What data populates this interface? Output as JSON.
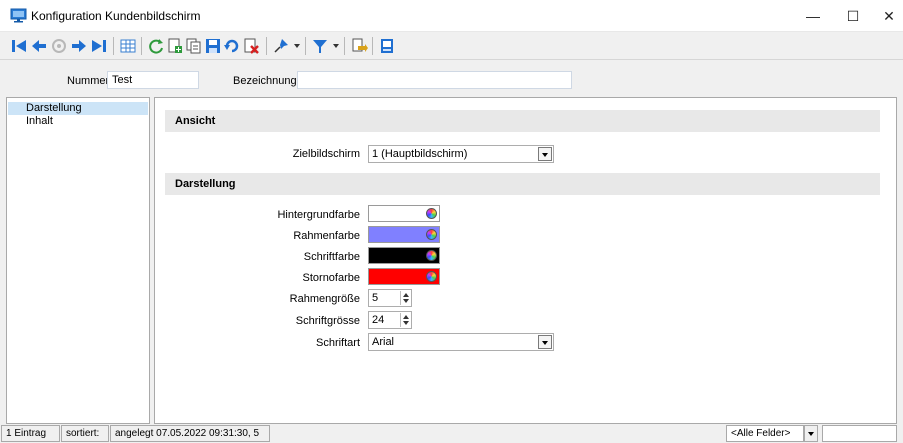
{
  "window": {
    "title": "Konfiguration Kundenbildschirm",
    "minimize": "—",
    "maximize": "☐",
    "close": "✕"
  },
  "header": {
    "nummer_label": "Nummer",
    "nummer_value": "Test",
    "bezeichnung_label": "Bezeichnung",
    "bezeichnung_value": ""
  },
  "nav": {
    "items": [
      {
        "label": "Darstellung",
        "selected": true
      },
      {
        "label": "Inhalt",
        "selected": false
      }
    ]
  },
  "sections": {
    "ansicht": "Ansicht",
    "darstellung": "Darstellung"
  },
  "fields": {
    "zielbildschirm": {
      "label": "Zielbildschirm",
      "value": "1 (Hauptbildschirm)"
    },
    "hintergrundfarbe": {
      "label": "Hintergrundfarbe",
      "color": "#ffffff"
    },
    "rahmenfarbe": {
      "label": "Rahmenfarbe",
      "color": "#8080ff"
    },
    "schriftfarbe": {
      "label": "Schriftfarbe",
      "color": "#000000"
    },
    "stornofarbe": {
      "label": "Stornofarbe",
      "color": "#ff0000"
    },
    "rahmengroesse": {
      "label": "Rahmengröße",
      "value": "5"
    },
    "schriftgroesse": {
      "label": "Schriftgrösse",
      "value": "24"
    },
    "schriftart": {
      "label": "Schriftart",
      "value": "Arial"
    }
  },
  "status": {
    "count": "1 Eintrag",
    "sorted": "sortiert:",
    "created": "angelegt 07.05.2022 09:31:30, 5",
    "filter_combo": "<Alle Felder>",
    "search_value": ""
  },
  "toolbar": {
    "icons": [
      "first-record-icon",
      "previous-record-icon",
      "refresh-record-icon",
      "next-record-icon",
      "last-record-icon",
      "table-view-icon",
      "reload-icon",
      "new-record-icon",
      "copy-record-icon",
      "save-icon",
      "undo-icon",
      "delete-record-icon",
      "pin-icon",
      "filter-icon",
      "export-icon",
      "print-preview-icon"
    ]
  }
}
